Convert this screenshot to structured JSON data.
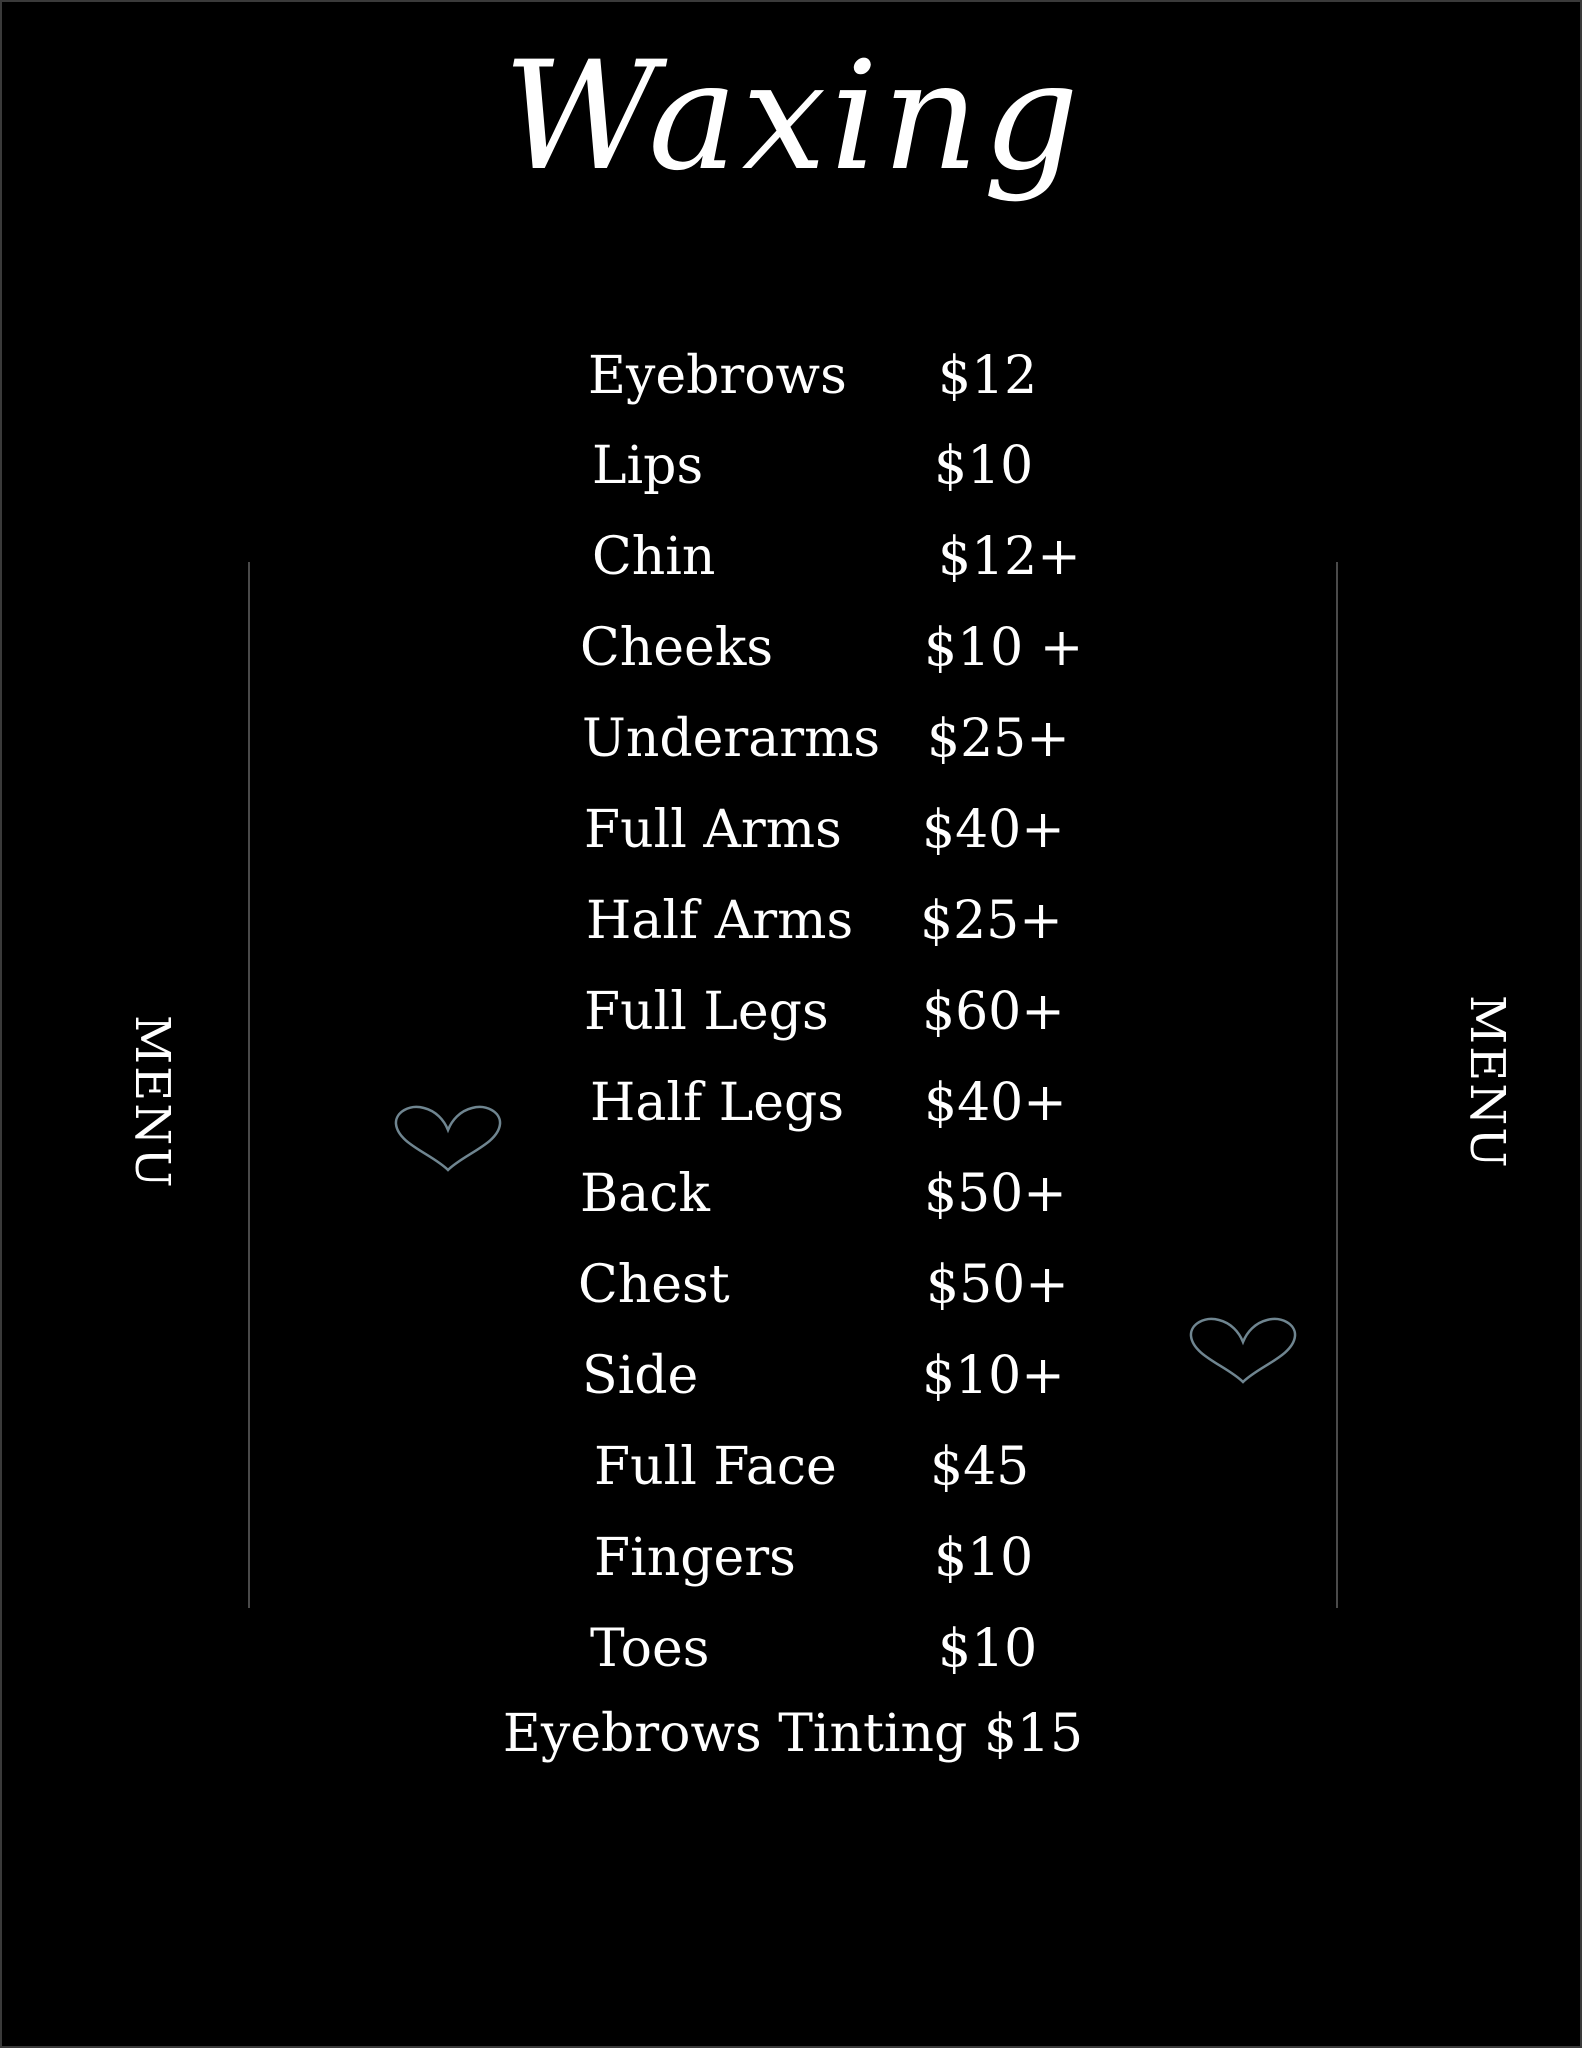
{
  "title": "Waxing",
  "side_label_left": "MENU",
  "side_label_right": "MENU",
  "items": [
    {
      "name": "Eyebrows",
      "price": "$12"
    },
    {
      "name": "Lips",
      "price": "$10"
    },
    {
      "name": "Chin",
      "price": "$12+"
    },
    {
      "name": "Cheeks",
      "price": "$10 +"
    },
    {
      "name": "Underarms",
      "price": "$25+"
    },
    {
      "name": "Full Arms",
      "price": "$40+"
    },
    {
      "name": "Half Arms",
      "price": "$25+"
    },
    {
      "name": "Full Legs",
      "price": "$60+"
    },
    {
      "name": "Half Legs",
      "price": "$40+"
    },
    {
      "name": "Back",
      "price": "$50+"
    },
    {
      "name": "Chest",
      "price": "$50+"
    },
    {
      "name": "Side",
      "price": "$10+"
    },
    {
      "name": "Full Face",
      "price": "$45"
    },
    {
      "name": "Fingers",
      "price": "$10"
    },
    {
      "name": "Toes",
      "price": "$10"
    }
  ],
  "footer_item": "Eyebrows Tinting $15",
  "colors": {
    "background": "#000000",
    "text": "#ffffff",
    "accent_lines": "#4a4a4a",
    "hearts": "#6f8590"
  },
  "icons": [
    "heart-outline-icon",
    "heart-outline-icon"
  ]
}
